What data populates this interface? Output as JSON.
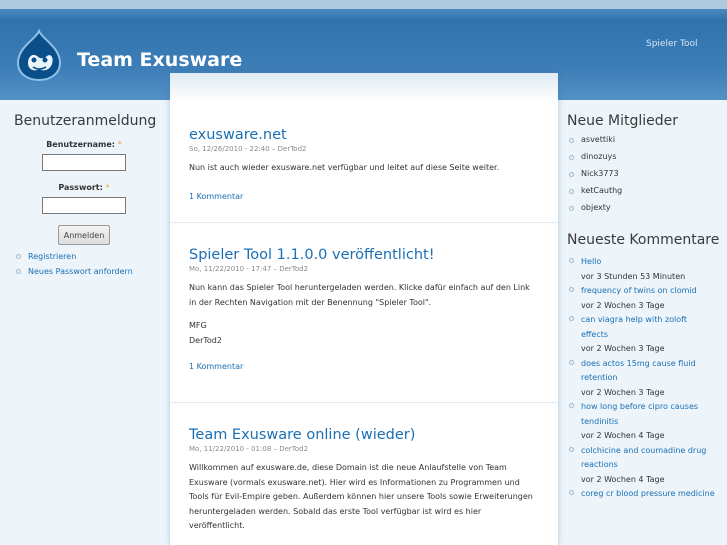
{
  "header": {
    "site_name": "Team Exusware",
    "primary_link": "Spieler Tool"
  },
  "login": {
    "title": "Benutzeranmeldung",
    "username_label": "Benutzername:",
    "password_label": "Passwort:",
    "required_mark": "*",
    "submit_label": "Anmelden",
    "links": [
      "Registrieren",
      "Neues Passwort anfordern"
    ]
  },
  "nodes": [
    {
      "title": "exusware.net",
      "meta": "So, 12/26/2010 - 22:40 – DerTod2",
      "body": [
        "Nun ist auch wieder exusware.net verfügbar und leitet auf diese Seite weiter."
      ],
      "link": "1 Kommentar"
    },
    {
      "title": "Spieler Tool 1.1.0.0 veröffentlicht!",
      "meta": "Mo, 11/22/2010 - 17:47 – DerTod2",
      "body": [
        "Nun kann das Spieler Tool heruntergeladen werden. Klicke dafür einfach auf den Link in der Rechten Navigation mit der Benennung \"Spieler Tool\".",
        "MFG\nDerTod2"
      ],
      "link": "1 Kommentar"
    },
    {
      "title": "Team Exusware online (wieder)",
      "meta": "Mo, 11/22/2010 - 01:08 – DerTod2",
      "body": [
        "Willkommen auf exusware.de, diese Domain ist die neue Anlaufstelle von Team Exusware (vormals exusware.net). Hier wird es Informationen zu Programmen und Tools für Evil-Empire geben. Außerdem können hier unsere Tools sowie Erweiterungen heruntergeladen werden. Sobald das erste Tool verfügbar ist wird es hier veröffentlicht."
      ],
      "link": ""
    }
  ],
  "new_members": {
    "title": "Neue Mitglieder",
    "items": [
      "asvettiki",
      "dinozuys",
      "Nick3773",
      "ketCauthg",
      "objexty"
    ]
  },
  "recent_comments": {
    "title": "Neueste Kommentare",
    "items": [
      {
        "text": "Hello",
        "time": "vor 3 Stunden 53 Minuten"
      },
      {
        "text": "frequency of twins on clomid",
        "time": "vor 2 Wochen 3 Tage"
      },
      {
        "text": "can viagra help with zoloft effects",
        "time": "vor 2 Wochen 3 Tage"
      },
      {
        "text": "does actos 15mg cause fluid retention",
        "time": "vor 2 Wochen 3 Tage"
      },
      {
        "text": "how long before cipro causes tendinitis",
        "time": "vor 2 Wochen 4 Tage"
      },
      {
        "text": "colchicine and coumadine drug reactions",
        "time": "vor 2 Wochen 4 Tage"
      },
      {
        "text": "coreg cr blood pressure medicine",
        "time": ""
      }
    ]
  },
  "colors": {
    "header_blue": "#2f72ac",
    "link_blue": "#1a6fb5",
    "page_bg": "#edf5fa"
  }
}
